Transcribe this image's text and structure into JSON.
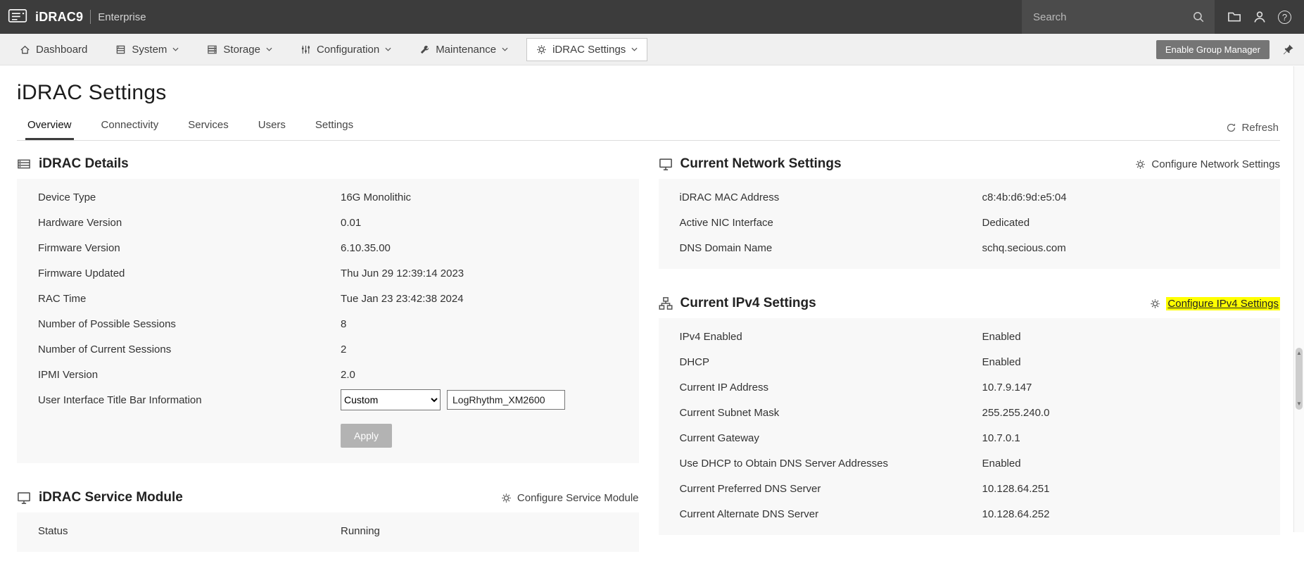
{
  "colors": {
    "header_bg": "#3c3c3c",
    "nav_bg": "#f0f0f0",
    "highlight": "#ffff00",
    "active_tab_underline": "#3d3d3d"
  },
  "header": {
    "brand": "iDRAC9",
    "edition": "Enterprise",
    "search_placeholder": "Search"
  },
  "nav": {
    "items": [
      {
        "label": "Dashboard"
      },
      {
        "label": "System"
      },
      {
        "label": "Storage"
      },
      {
        "label": "Configuration"
      },
      {
        "label": "Maintenance"
      },
      {
        "label": "iDRAC Settings"
      }
    ],
    "group_manager_label": "Enable Group Manager"
  },
  "page": {
    "title": "iDRAC Settings",
    "tabs": [
      {
        "label": "Overview"
      },
      {
        "label": "Connectivity"
      },
      {
        "label": "Services"
      },
      {
        "label": "Users"
      },
      {
        "label": "Settings"
      }
    ],
    "refresh_label": "Refresh"
  },
  "cards": {
    "idrac_details": {
      "title": "iDRAC Details",
      "rows": [
        {
          "label": "Device Type",
          "value": "16G Monolithic"
        },
        {
          "label": "Hardware Version",
          "value": "0.01"
        },
        {
          "label": "Firmware Version",
          "value": "6.10.35.00"
        },
        {
          "label": "Firmware Updated",
          "value": "Thu Jun 29 12:39:14 2023"
        },
        {
          "label": "RAC Time",
          "value": "Tue Jan 23 23:42:38 2024"
        },
        {
          "label": "Number of Possible Sessions",
          "value": "8"
        },
        {
          "label": "Number of Current Sessions",
          "value": "2"
        },
        {
          "label": "IPMI Version",
          "value": "2.0"
        }
      ],
      "title_bar": {
        "label": "User Interface Title Bar Information",
        "select_value": "Custom",
        "input_value": "LogRhythm_XM2600"
      },
      "apply_label": "Apply"
    },
    "service_module": {
      "title": "iDRAC Service Module",
      "action_label": "Configure Service Module",
      "rows": [
        {
          "label": "Status",
          "value": "Running"
        }
      ]
    },
    "network": {
      "title": "Current Network Settings",
      "action_label": "Configure Network Settings",
      "rows": [
        {
          "label": "iDRAC MAC Address",
          "value": "c8:4b:d6:9d:e5:04"
        },
        {
          "label": "Active NIC Interface",
          "value": "Dedicated"
        },
        {
          "label": "DNS Domain Name",
          "value": "schq.secious.com"
        }
      ]
    },
    "ipv4": {
      "title": "Current IPv4 Settings",
      "action_label": "Configure IPv4 Settings",
      "rows": [
        {
          "label": "IPv4 Enabled",
          "value": "Enabled"
        },
        {
          "label": "DHCP",
          "value": "Enabled"
        },
        {
          "label": "Current IP Address",
          "value": "10.7.9.147"
        },
        {
          "label": "Current Subnet Mask",
          "value": "255.255.240.0"
        },
        {
          "label": "Current Gateway",
          "value": "10.7.0.1"
        },
        {
          "label": "Use DHCP to Obtain DNS Server Addresses",
          "value": "Enabled"
        },
        {
          "label": "Current Preferred DNS Server",
          "value": "10.128.64.251"
        },
        {
          "label": "Current Alternate DNS Server",
          "value": "10.128.64.252"
        }
      ]
    }
  }
}
